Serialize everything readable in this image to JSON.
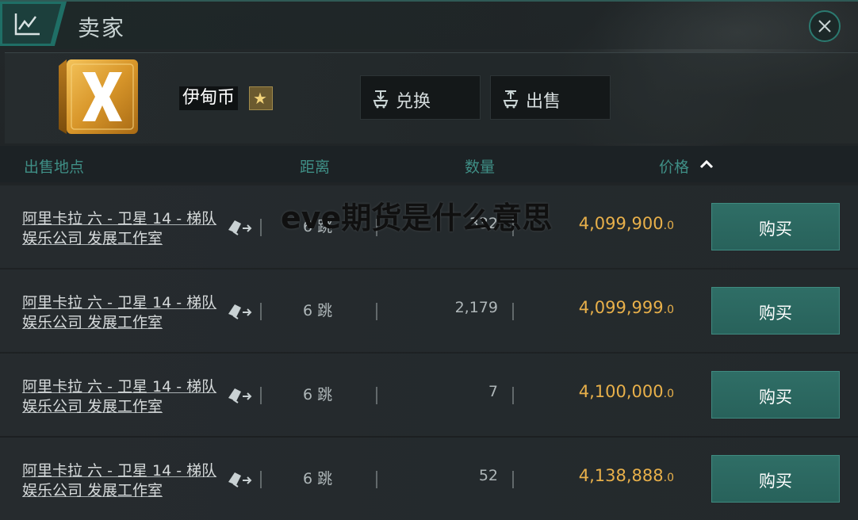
{
  "window": {
    "title": "卖家"
  },
  "item": {
    "name": "伊甸币",
    "icon": "isk-x-cube-icon",
    "badge_icon": "star-icon",
    "actions": [
      {
        "label": "兑换",
        "icon": "exchange-icon"
      },
      {
        "label": "出售",
        "icon": "sell-icon"
      }
    ]
  },
  "table": {
    "columns": {
      "location": "出售地点",
      "distance": "距离",
      "quantity": "数量",
      "price": "价格"
    },
    "sort": {
      "column": "price",
      "direction": "ascending"
    },
    "buy_label": "购买",
    "rows": [
      {
        "location": "阿里卡拉 六 - 卫星 14 - 梯队娱乐公司 发展工作室",
        "jumps": "6 跳",
        "quantity": "332",
        "price": "4,099,900",
        "price_decimal": ".0"
      },
      {
        "location": "阿里卡拉 六 - 卫星 14 - 梯队娱乐公司 发展工作室",
        "jumps": "6 跳",
        "quantity": "2,179",
        "price": "4,099,999",
        "price_decimal": ".0"
      },
      {
        "location": "阿里卡拉 六 - 卫星 14 - 梯队娱乐公司 发展工作室",
        "jumps": "6 跳",
        "quantity": "7",
        "price": "4,100,000",
        "price_decimal": ".0"
      },
      {
        "location": "阿里卡拉 六 - 卫星 14 - 梯队娱乐公司 发展工作室",
        "jumps": "6 跳",
        "quantity": "52",
        "price": "4,138,888",
        "price_decimal": ".0"
      }
    ]
  },
  "overlay": {
    "watermark": "eve期货是什么意思"
  },
  "colors": {
    "accent": "#2f6e66",
    "price": "#e8b04a",
    "header_text": "#3f8f86"
  }
}
